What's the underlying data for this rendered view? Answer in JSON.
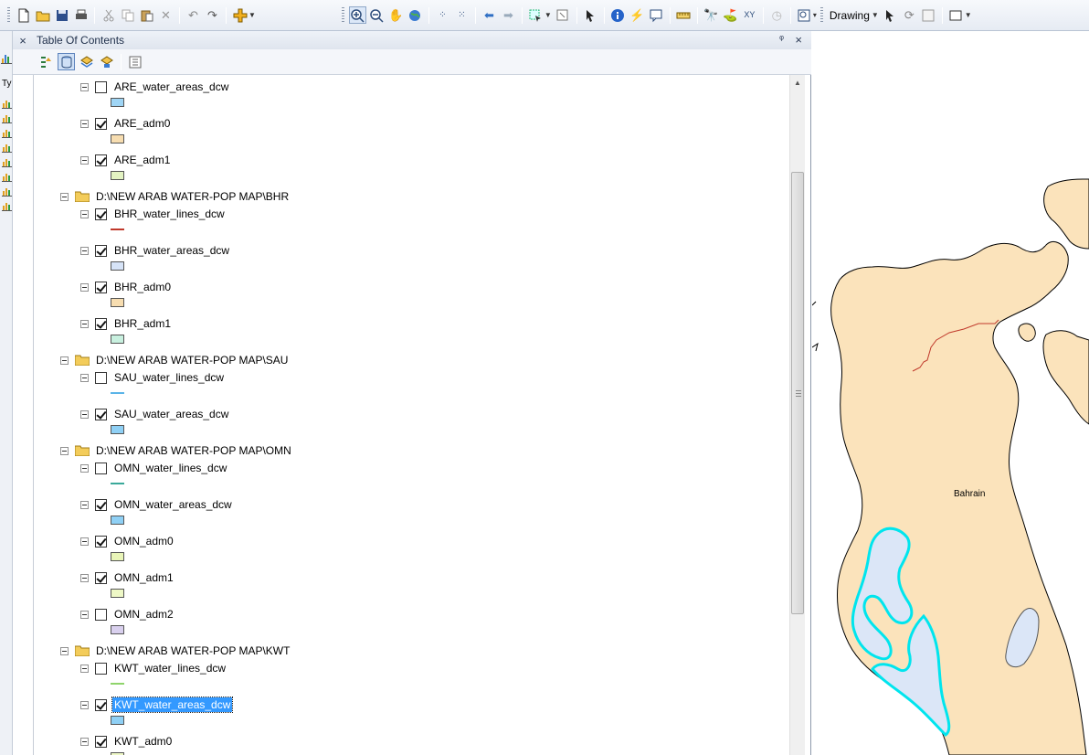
{
  "toolbar": {
    "drawing_label": "Drawing",
    "icons": [
      "new-document",
      "open-folder",
      "save",
      "print",
      "cut",
      "copy",
      "paste",
      "delete",
      "undo",
      "redo",
      "add-data",
      "zoom-in",
      "zoom-out",
      "pan",
      "full-extent",
      "fixed-zoom-in",
      "fixed-zoom-out",
      "back",
      "forward",
      "select-features",
      "clear-selection",
      "select-elements",
      "identify",
      "hyperlink",
      "html-popup",
      "measure",
      "find",
      "go-to-xy",
      "coordinates",
      "time-slider",
      "create-viewer-window",
      "drawing-pointer",
      "rotate",
      "text",
      "rectangle"
    ]
  },
  "left_strip": {
    "tab_label": "Ty"
  },
  "toc": {
    "title": "Table Of Contents",
    "close_glyph": "×",
    "pin_glyph": "ᵠ",
    "items": [
      {
        "kind": "layer",
        "label": "ARE_water_areas_dcw",
        "checked": false,
        "symbol": "fill",
        "color": "#9fd5f5"
      },
      {
        "kind": "layer",
        "label": "ARE_adm0",
        "checked": true,
        "symbol": "fill",
        "color": "#f7ddb0"
      },
      {
        "kind": "layer",
        "label": "ARE_adm1",
        "checked": true,
        "symbol": "fill",
        "color": "#e3f3c2"
      },
      {
        "kind": "group",
        "label": "D:\\NEW ARAB WATER-POP MAP\\BHR"
      },
      {
        "kind": "layer",
        "label": "BHR_water_lines_dcw",
        "checked": true,
        "symbol": "line",
        "color": "#c0392b"
      },
      {
        "kind": "layer",
        "label": "BHR_water_areas_dcw",
        "checked": true,
        "symbol": "fill",
        "color": "#d6e3f7"
      },
      {
        "kind": "layer",
        "label": "BHR_adm0",
        "checked": true,
        "symbol": "fill",
        "color": "#f7ddb0"
      },
      {
        "kind": "layer",
        "label": "BHR_adm1",
        "checked": true,
        "symbol": "fill",
        "color": "#c8f0df"
      },
      {
        "kind": "group",
        "label": "D:\\NEW ARAB WATER-POP MAP\\SAU"
      },
      {
        "kind": "layer",
        "label": "SAU_water_lines_dcw",
        "checked": false,
        "symbol": "line",
        "color": "#5ab4e8"
      },
      {
        "kind": "layer",
        "label": "SAU_water_areas_dcw",
        "checked": true,
        "symbol": "fill",
        "color": "#8fd0f5"
      },
      {
        "kind": "group",
        "label": "D:\\NEW ARAB WATER-POP MAP\\OMN"
      },
      {
        "kind": "layer",
        "label": "OMN_water_lines_dcw",
        "checked": false,
        "symbol": "line",
        "color": "#3aa99a"
      },
      {
        "kind": "layer",
        "label": "OMN_water_areas_dcw",
        "checked": true,
        "symbol": "fill",
        "color": "#8fd0f5"
      },
      {
        "kind": "layer",
        "label": "OMN_adm0",
        "checked": true,
        "symbol": "fill",
        "color": "#e9f5b8"
      },
      {
        "kind": "layer",
        "label": "OMN_adm1",
        "checked": true,
        "symbol": "fill",
        "color": "#eef8c6"
      },
      {
        "kind": "layer",
        "label": "OMN_adm2",
        "checked": false,
        "symbol": "fill",
        "color": "#d9d0ee"
      },
      {
        "kind": "group",
        "label": "D:\\NEW ARAB WATER-POP MAP\\KWT"
      },
      {
        "kind": "layer",
        "label": "KWT_water_lines_dcw",
        "checked": false,
        "symbol": "line",
        "color": "#8fd46b"
      },
      {
        "kind": "layer",
        "label": "KWT_water_areas_dcw",
        "checked": true,
        "symbol": "fill",
        "color": "#8fd0f5",
        "selected": true
      },
      {
        "kind": "layer",
        "label": "KWT_adm0",
        "checked": true,
        "symbol": "fill",
        "color": "#eef8c6"
      }
    ]
  },
  "map": {
    "label": "Bahrain",
    "land_color": "#fbe3bb",
    "water_color": "#dbe6f7",
    "water_outline_color": "#00e5ee",
    "river_color": "#c0392b"
  }
}
